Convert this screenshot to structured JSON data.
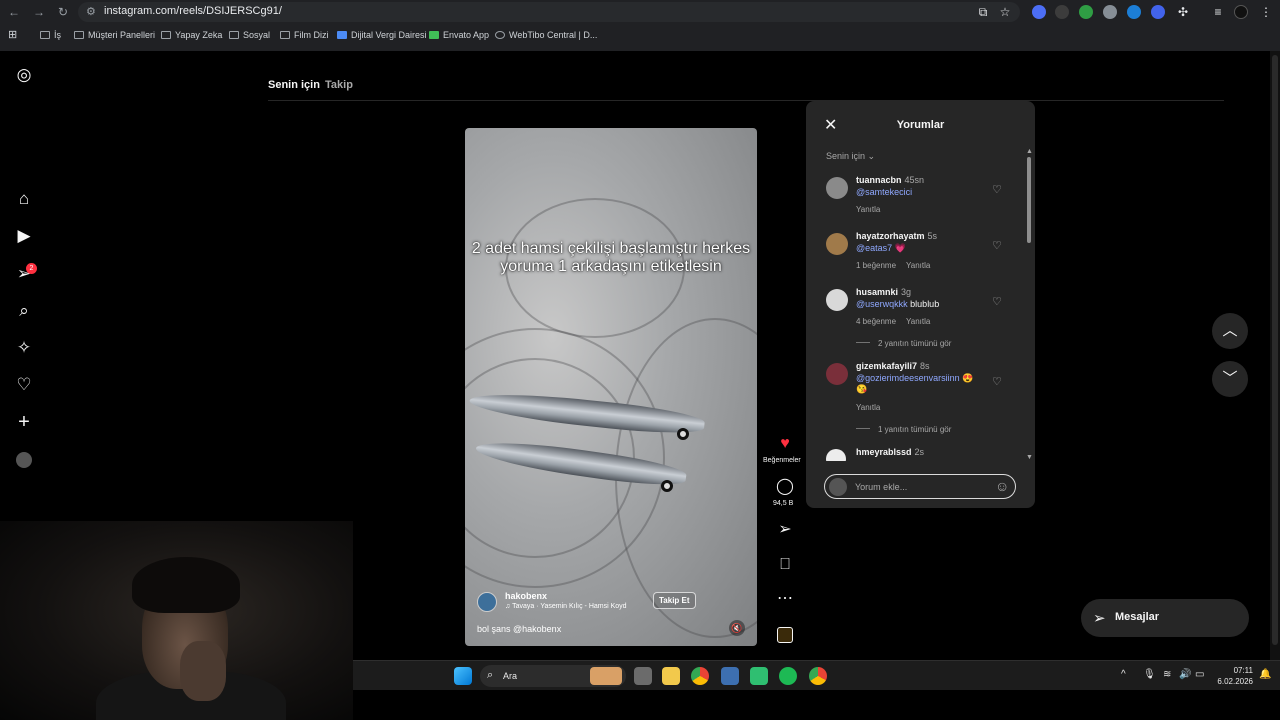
{
  "browser": {
    "url": "instagram.com/reels/DSIJERSCg91/",
    "bookmarks": [
      "İş",
      "Müşteri Panelleri",
      "Yapay Zeka",
      "Sosyal",
      "Film Dizi",
      "Dijital Vergi Dairesi",
      "Envato App",
      "WebTibo Central | D..."
    ]
  },
  "nav_icons": [
    "instagram-logo-icon",
    "home-icon",
    "reels-icon",
    "direct-icon",
    "search-icon",
    "explore-icon",
    "heart-icon",
    "create-icon",
    "profile-avatar"
  ],
  "notifications_badge": "2",
  "tabs": {
    "for_you": "Senin için",
    "following": "Takip"
  },
  "reel": {
    "overlay_text": "2 adet hamsi çekilişi başlamıştır herkes yoruma 1 arkadaşını etiketlesin",
    "author": "hakobenx",
    "music": "♫ Tavaya · Yasemin Kılıç - Hamsi Koyd",
    "follow_label": "Takip Et",
    "caption": "bol şans @hakobenx"
  },
  "actions": {
    "likes_label": "Beğenmeler",
    "comments_count": "94,5 B"
  },
  "comments_panel": {
    "title": "Yorumlar",
    "sort_label": "Senin için",
    "input_placeholder": "Yorum ekle...",
    "comments": [
      {
        "user": "tuannacbn",
        "time": "45sn",
        "mention": "@samtekecici",
        "text": "",
        "likes": "",
        "reply": "Yanıtla",
        "view_replies": ""
      },
      {
        "user": "hayatzorhayatm",
        "time": "5s",
        "mention": "@eatas7",
        "text": "💗",
        "likes": "1 beğenme",
        "reply": "Yanıtla",
        "view_replies": ""
      },
      {
        "user": "husamnki",
        "time": "3g",
        "mention": "@userwqkkk",
        "text": "blublub",
        "likes": "4 beğenme",
        "reply": "Yanıtla",
        "view_replies": "2 yanıtın tümünü gör"
      },
      {
        "user": "gizemkafayili7",
        "time": "8s",
        "mention": "@gozierimdeesenvarsiinn",
        "text": "😍😘",
        "likes": "",
        "reply": "Yanıtla",
        "view_replies": "1 yanıtın tümünü gör"
      },
      {
        "user": "hmeyrablssd",
        "time": "2s",
        "mention": "",
        "text": "",
        "likes": "",
        "reply": "",
        "view_replies": ""
      }
    ]
  },
  "messages_button": "Mesajlar",
  "taskbar": {
    "search_label": "Ara",
    "time": "07:11",
    "date": "6.02.2026"
  }
}
